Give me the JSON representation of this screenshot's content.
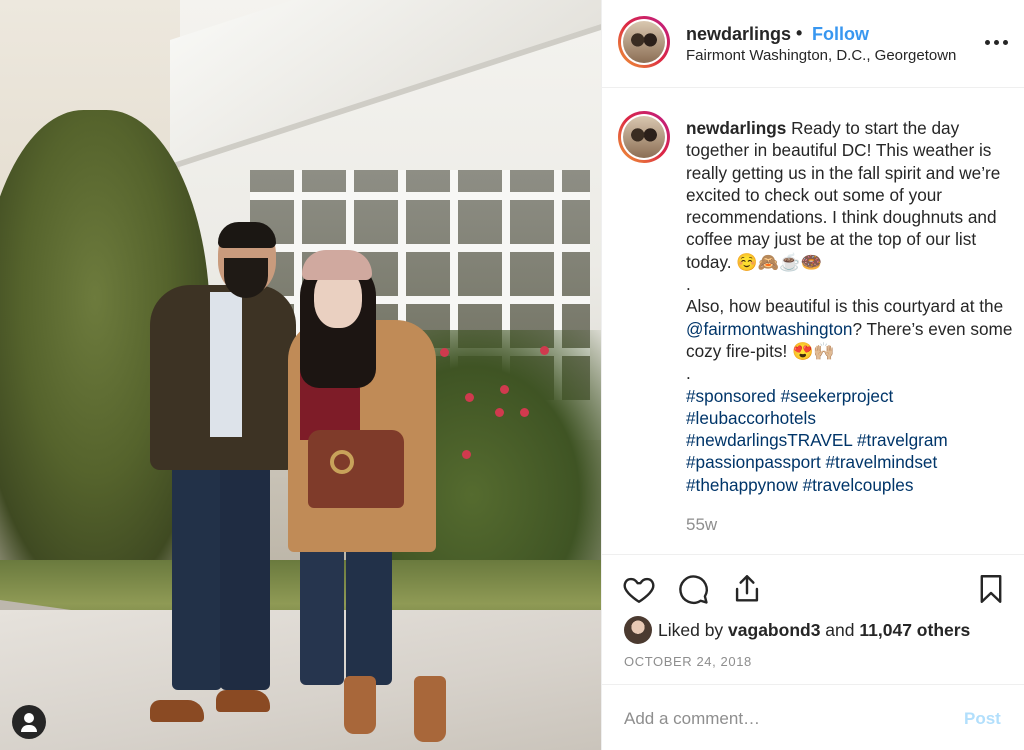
{
  "header": {
    "username": "newdarlings",
    "separator": "•",
    "follow_label": "Follow",
    "location": "Fairmont Washington, D.C., Georgetown",
    "more_icon": "more-horizontal-icon"
  },
  "caption": {
    "username": "newdarlings",
    "line1": "Ready to start the day together in beautiful DC! This weather is really getting us in the fall spirit and we’re excited to check out some of your recommendations. I think doughnuts and coffee may just be at the top of our list today. ☺️🙈☕🍩",
    "dot1": ".",
    "line2_before": "Also, how beautiful is this courtyard at the ",
    "mention": "@fairmontwashington",
    "line2_after": "? There’s even some cozy fire-pits! 😍🙌🏼",
    "dot2": ".",
    "hashtags_line1": "#sponsored #seekerproject",
    "hashtags_line2": "#leubaccorhotels",
    "hashtags_line3": "#newdarlingsTRAVEL #travelgram",
    "hashtags_line4": "#passionpassport #travelmindset",
    "hashtags_line5": "#thehappynow #travelcouples",
    "time_ago": "55w"
  },
  "actions": {
    "like_icon": "heart-icon",
    "comment_icon": "comment-icon",
    "share_icon": "share-icon",
    "save_icon": "bookmark-icon"
  },
  "likes": {
    "prefix": "Liked by ",
    "user": "vagabond3",
    "middle": " and ",
    "count": "11,047 others"
  },
  "date": "OCTOBER 24, 2018",
  "comment": {
    "placeholder": "Add a comment…",
    "post_label": "Post"
  },
  "colors": {
    "link": "#003569",
    "follow": "#3897f0",
    "post_disabled": "#b2dffc",
    "muted": "#8e8e8e"
  }
}
